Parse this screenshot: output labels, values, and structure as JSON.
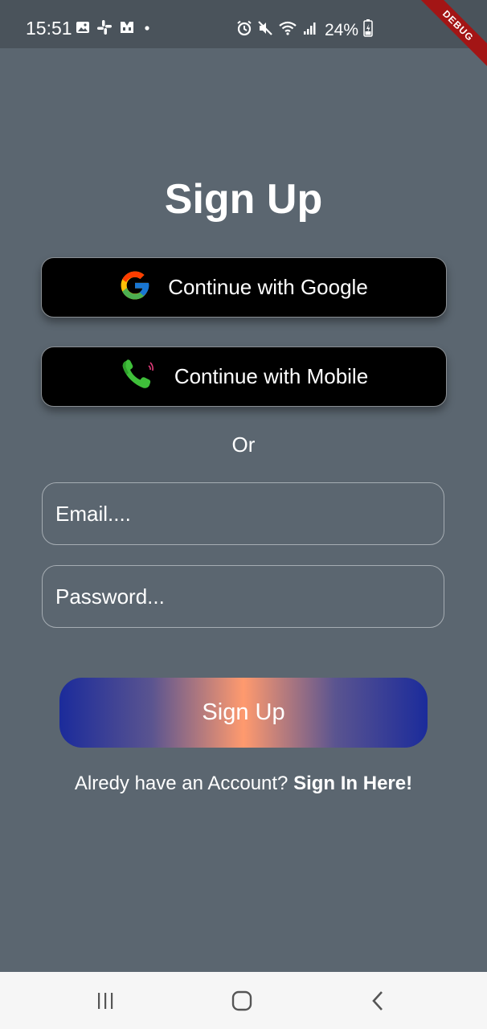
{
  "status_bar": {
    "time": "15:51",
    "battery": "24%",
    "debug_label": "DEBUG"
  },
  "page": {
    "title": "Sign Up",
    "or_text": "Or"
  },
  "buttons": {
    "google_label": "Continue with Google",
    "mobile_label": "Continue with Mobile",
    "signup_label": "Sign Up"
  },
  "form": {
    "email_placeholder": "Email....",
    "email_value": "",
    "password_placeholder": "Password...",
    "password_value": ""
  },
  "footer": {
    "prompt": "Alredy have an Account? ",
    "link": "Sign In Here!"
  },
  "icons": {
    "google": "google-icon",
    "phone": "phone-icon",
    "nav_recent": "recent-apps-icon",
    "nav_home": "home-icon",
    "nav_back": "back-icon"
  },
  "colors": {
    "background": "#5b6670",
    "button_bg": "#000000",
    "gradient_edge": "#1b2b9b",
    "gradient_center": "#ff9a6e",
    "phone_green": "#3fbf3a"
  }
}
